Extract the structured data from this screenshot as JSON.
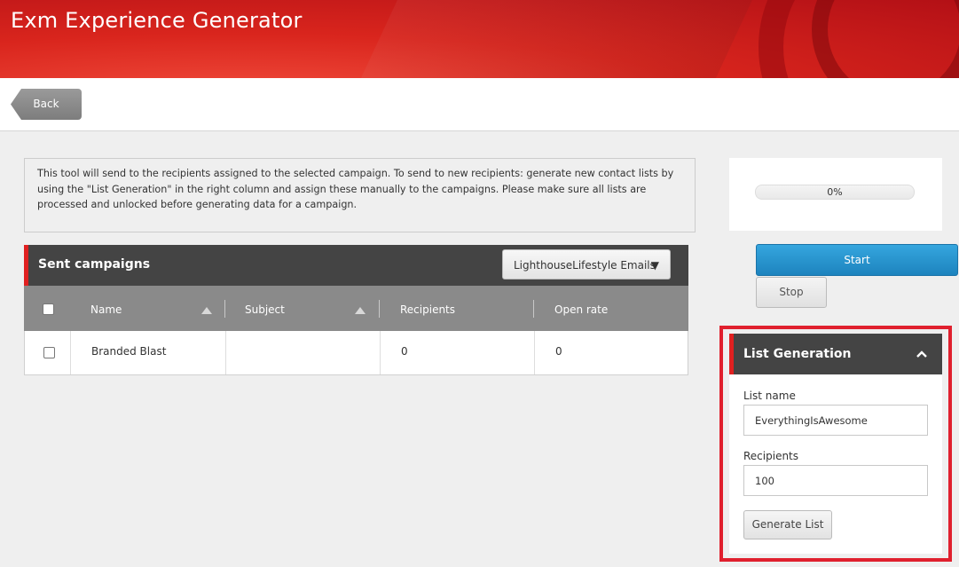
{
  "app": {
    "title": "Exm Experience Generator"
  },
  "toolbar": {
    "back_label": "Back"
  },
  "info": {
    "text": "This tool will send to the recipients assigned to the selected campaign. To send to new recipients: generate new contact lists by using the \"List Generation\" in the right column and assign these manually to the campaigns. Please make sure all lists are processed and unlocked before generating data for a campaign."
  },
  "campaigns": {
    "title": "Sent campaigns",
    "selected_manager": "LighthouseLifestyle Emails",
    "columns": [
      "Name",
      "Subject",
      "Recipients",
      "Open rate"
    ],
    "rows": [
      {
        "name": "Branded Blast",
        "subject": "",
        "recipients": "0",
        "open_rate": "0"
      }
    ]
  },
  "progress": {
    "value": 0,
    "label": "0%"
  },
  "actions": {
    "start_label": "Start",
    "stop_label": "Stop"
  },
  "list_generation": {
    "title": "List Generation",
    "list_name_label": "List name",
    "list_name_value": "EverythingIsAwesome",
    "recipients_label": "Recipients",
    "recipients_value": "100",
    "generate_label": "Generate List"
  },
  "colors": {
    "header_red": "#d9251d",
    "accent_red": "#e02020",
    "start_blue": "#1d83be",
    "panel_dark": "#444444"
  }
}
